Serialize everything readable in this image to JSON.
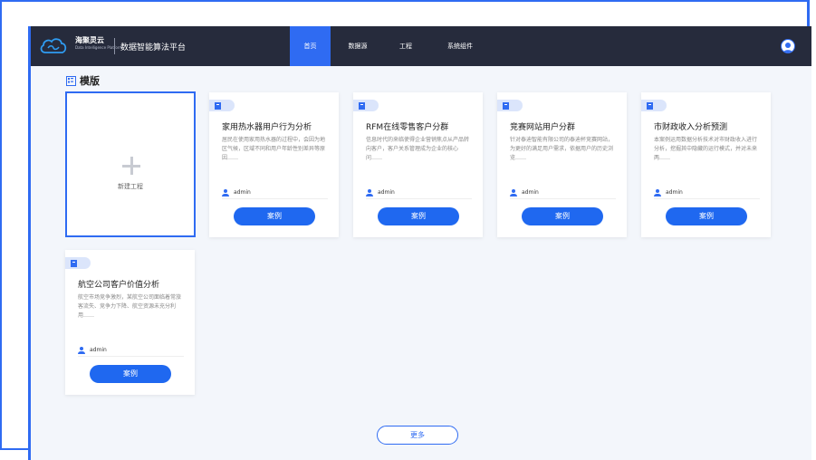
{
  "header": {
    "brand_name": "海聚灵云",
    "brand_sub": "Data Intelligence Platform",
    "platform_title": "数据智能算法平台",
    "nav": [
      {
        "label": "首页",
        "active": true
      },
      {
        "label": "数据源",
        "active": false
      },
      {
        "label": "工程",
        "active": false
      },
      {
        "label": "系统组件",
        "active": false
      }
    ]
  },
  "section": {
    "title": "模版",
    "icon": "template-grid-icon"
  },
  "new_project": {
    "label": "新建工程",
    "icon": "plus-icon"
  },
  "cards": [
    {
      "title": "家用热水器用户行为分析",
      "desc": "居民在使用家用热水器的过程中，会因为地区气候，区域不同和用户年龄性别差异等原因……",
      "user": "admin",
      "button": "案例"
    },
    {
      "title": "RFM在线零售客户分群",
      "desc": "信息时代的来临使得企业营销焦点从产品转向客户，客户关系管理成为企业的核心问……",
      "user": "admin",
      "button": "案例"
    },
    {
      "title": "竞赛网站用户分群",
      "desc": "针对泰迪智能有限公司的泰迪杯竞赛网站，为更好的满足用户需求，依据用户的历史浏览……",
      "user": "admin",
      "button": "案例"
    },
    {
      "title": "市财政收入分析预测",
      "desc": "本案例运用数据分析技术对市财政收入进行分析，挖掘其中隐藏的运行模式，并对未来两……",
      "user": "admin",
      "button": "案例"
    },
    {
      "title": "航空公司客户价值分析",
      "desc": "航空市场竞争激烈，某航空公司面临着常旅客流失、竞争力下降、航空资源未充分利用……",
      "user": "admin",
      "button": "案例"
    }
  ],
  "more_button": "更多",
  "colors": {
    "accent": "#2f6bf2",
    "header_bg": "#262b3c",
    "button": "#1f68f0"
  }
}
